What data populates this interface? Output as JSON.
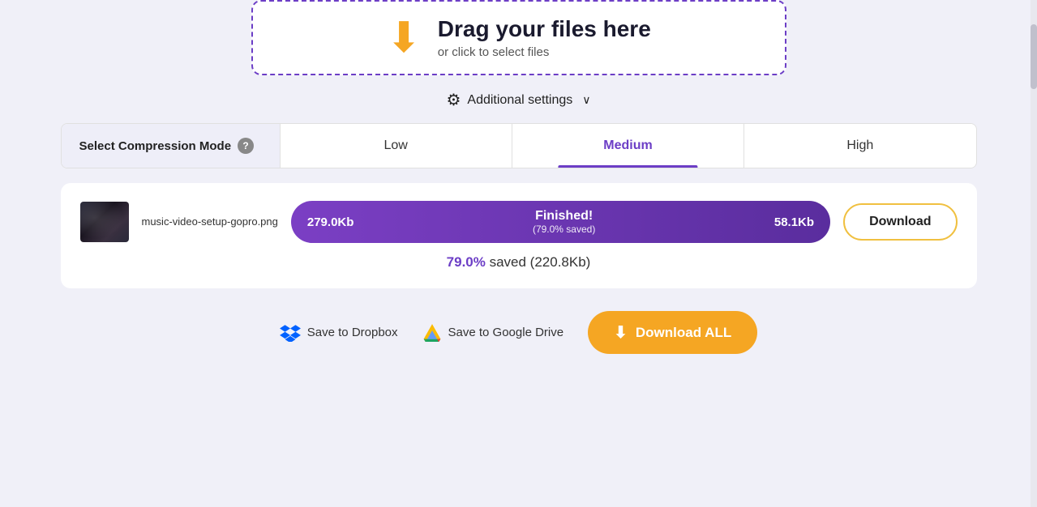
{
  "dropzone": {
    "title": "Drag your files here",
    "subtitle": "or click to select files"
  },
  "settings": {
    "label": "Additional settings",
    "chevron": "∨"
  },
  "compression": {
    "label": "Select Compression Mode",
    "options": [
      {
        "id": "low",
        "label": "Low",
        "active": false
      },
      {
        "id": "medium",
        "label": "Medium",
        "active": true
      },
      {
        "id": "high",
        "label": "High",
        "active": false
      }
    ]
  },
  "result": {
    "filename": "music-video-setup-gopro.png",
    "original_size": "279.0Kb",
    "compressed_size": "58.1Kb",
    "status": "Finished!",
    "saved_pct_bar": "(79.0% saved)",
    "saved_summary_pct": "79.0%",
    "saved_summary_text": " saved (220.8Kb)"
  },
  "buttons": {
    "download": "Download",
    "save_dropbox": "Save to Dropbox",
    "save_gdrive": "Save to Google Drive",
    "download_all": "Download ALL"
  }
}
